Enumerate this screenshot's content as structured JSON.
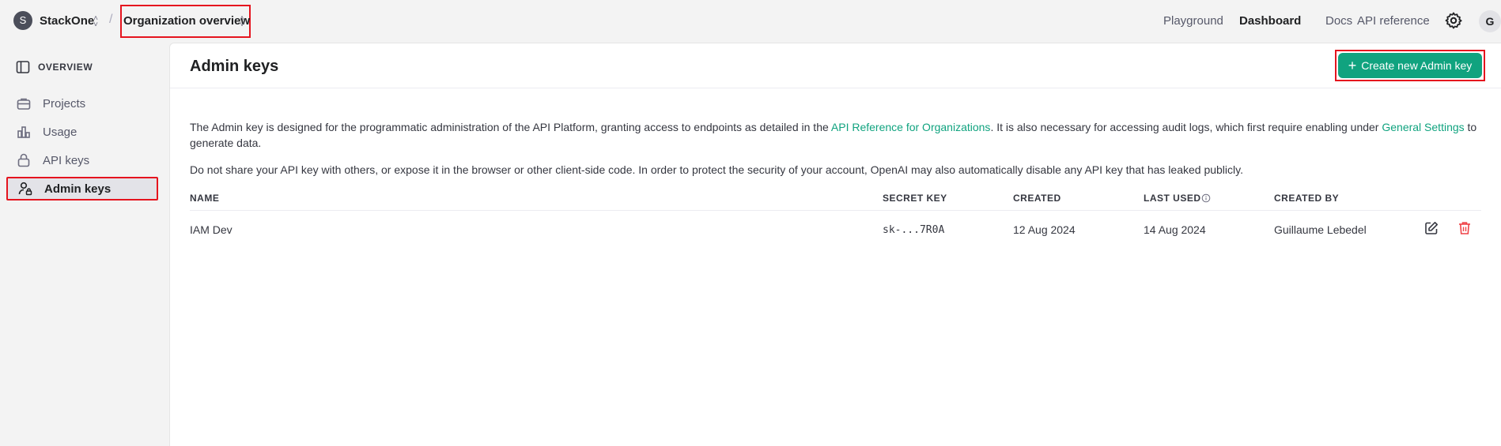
{
  "topbar": {
    "org_initial": "S",
    "org_name": "StackOne",
    "separator": "/",
    "project_name": "Organization overview",
    "nav": [
      "Playground",
      "Dashboard",
      "Docs",
      "API reference"
    ],
    "active_nav": "Dashboard",
    "user_initial": "G"
  },
  "sidebar": {
    "heading": "OVERVIEW",
    "items": [
      {
        "label": "Projects",
        "icon": "briefcase-icon"
      },
      {
        "label": "Usage",
        "icon": "bar-chart-icon"
      },
      {
        "label": "API keys",
        "icon": "lock-icon"
      },
      {
        "label": "Admin keys",
        "icon": "user-lock-icon",
        "active": true
      }
    ]
  },
  "main": {
    "title": "Admin keys",
    "create_button": "Create new Admin key",
    "para1_a": "The Admin key is designed for the programmatic administration of the API Platform, granting access to endpoints as detailed in the ",
    "para1_link1": "API Reference for Organizations",
    "para1_b": ". It is also necessary for accessing audit logs, which first require enabling under ",
    "para1_link2": "General Settings",
    "para1_c": " to generate data.",
    "para2": "Do not share your API key with others, or expose it in the browser or other client-side code. In order to protect the security of your account, OpenAI may also automatically disable any API key that has leaked publicly.",
    "table": {
      "headers": [
        "NAME",
        "SECRET KEY",
        "CREATED",
        "LAST USED",
        "CREATED BY"
      ],
      "rows": [
        {
          "name": "IAM Dev",
          "secret_key": "sk-...7R0A",
          "created": "12 Aug 2024",
          "last_used": "14 Aug 2024",
          "created_by": "Guillaume Lebedel"
        }
      ]
    }
  },
  "colors": {
    "accent": "#10a37f",
    "highlight": "#e5141e",
    "delete": "#ef4146"
  }
}
